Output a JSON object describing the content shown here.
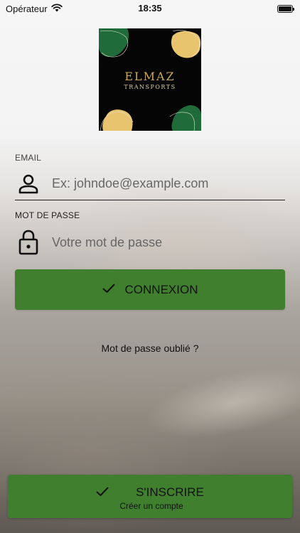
{
  "status_bar": {
    "carrier": "Opérateur",
    "time": "18:35"
  },
  "logo": {
    "title": "ELMAZ",
    "subtitle": "TRANSPORTS",
    "colors": {
      "background": "#050505",
      "green": "#1f6b3a",
      "gold": "#e8c46e"
    }
  },
  "login": {
    "email_label": "EMAIL",
    "email_placeholder": "Ex: johndoe@example.com",
    "password_label": "MOT DE PASSE",
    "password_placeholder": "Votre mot de passe",
    "submit_label": "CONNEXION",
    "forgot_password": "Mot de passe oublié ?"
  },
  "signup": {
    "label": "S'INSCRIRE",
    "sublabel": "Créer un compte"
  },
  "icons": {
    "email_field": "user-icon",
    "password_field": "lock-icon",
    "buttons": "check-icon"
  },
  "colors": {
    "button_green": "#3f7f2e",
    "text_dark": "#111111"
  }
}
